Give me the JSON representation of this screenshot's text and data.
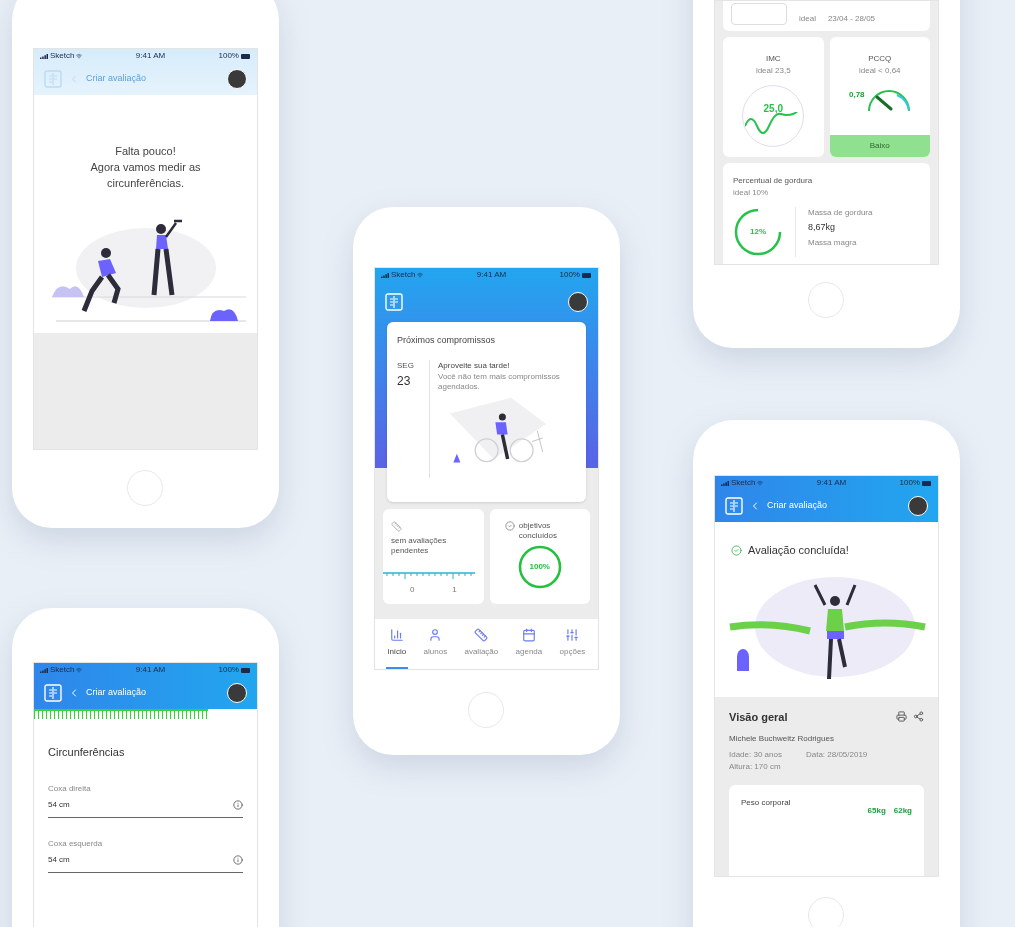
{
  "phones": [
    {
      "kind": "intro",
      "status": {
        "carrier": "Sketch",
        "time": "9:41 AM",
        "battery": "100%"
      },
      "header": {
        "title": "Criar avaliação"
      },
      "message": "Falta pouco!\nAgora vamos medir as\ncircunferências."
    },
    {
      "kind": "stats",
      "top_card": {
        "label": "ideal",
        "range": "23/04 - 28/05"
      },
      "imc": {
        "title": "IMC",
        "ideal": "ideal 23,5",
        "value": "25,0"
      },
      "pccq": {
        "title": "PCCQ",
        "ideal": "ideal < 0,64",
        "value": "0,78",
        "rating": "Baixo"
      },
      "fat": {
        "title": "Percentual de gordura",
        "ideal": "ideal 10%",
        "value": "12%",
        "fat_mass_label": "Massa de gordura",
        "fat_mass": "8,67kg",
        "lean_mass_label": "Massa magra"
      }
    },
    {
      "kind": "home",
      "status": {
        "carrier": "Sketch",
        "time": "9:41 AM",
        "battery": "100%"
      },
      "appointments": {
        "title": "Próximos compromissos",
        "weekday": "SEG",
        "day": "23",
        "heading": "Aproveite sua tarde!",
        "text": "Você não tem mais compromissos agendados."
      },
      "pending": {
        "text": "sem avaliações pendentes",
        "ticks": [
          "0",
          "1"
        ]
      },
      "goals": {
        "text": "objetivos concluídos",
        "value": "100%",
        "level": 1
      },
      "nav": [
        {
          "label": "início",
          "selected": true
        },
        {
          "label": "alunos",
          "selected": false
        },
        {
          "label": "avaliação",
          "selected": false
        },
        {
          "label": "agenda",
          "selected": false
        },
        {
          "label": "opções",
          "selected": false
        }
      ]
    },
    {
      "kind": "form",
      "status": {
        "carrier": "Sketch",
        "time": "9:41 AM",
        "battery": "100%"
      },
      "header": {
        "title": "Criar avaliação"
      },
      "progress": {
        "level": 0.78
      },
      "title": "Circunferências",
      "fields": [
        {
          "label": "Coxa direita",
          "value": "54 cm"
        },
        {
          "label": "Coxa esquerda",
          "value": "54 cm"
        }
      ]
    },
    {
      "kind": "result",
      "status": {
        "carrier": "Sketch",
        "time": "9:41 AM",
        "battery": "100%"
      },
      "header": {
        "title": "Criar avaliação"
      },
      "banner": "Avaliação concluída!",
      "overview": {
        "title": "Visão geral",
        "name": "Michele Buchweitz Rodrigues",
        "age": "Idade: 30 anos",
        "date": "Data: 28/05/2019",
        "height": "Altura: 170 cm"
      },
      "weight": {
        "title": "Peso corporal",
        "values": [
          "65kg",
          "62kg"
        ]
      }
    }
  ]
}
